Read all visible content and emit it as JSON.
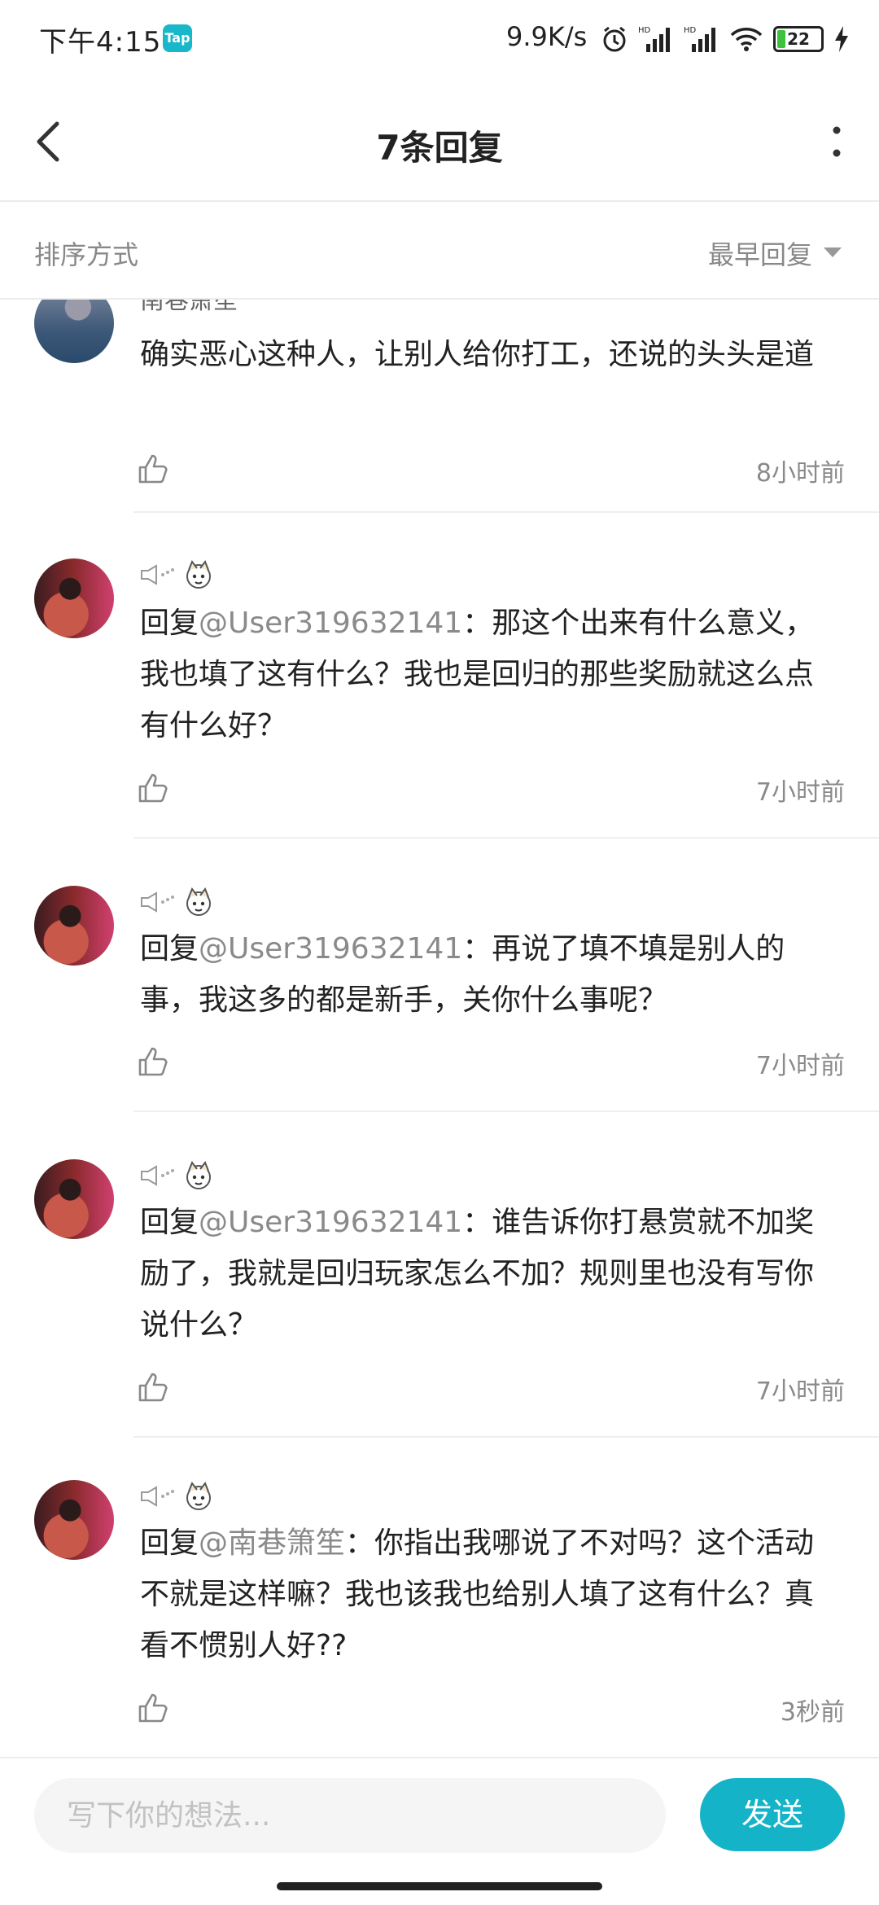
{
  "status_bar": {
    "time": "下午4:15",
    "app_badge": "Tap",
    "speed": "9.9K/s",
    "battery": "22"
  },
  "header": {
    "title": "7条回复",
    "icons": [
      "back-icon",
      "more-vertical-icon"
    ]
  },
  "sort": {
    "label": "排序方式",
    "value": "最早回复"
  },
  "comments": [
    {
      "author_partial": "南巷箫笙",
      "prefix": "",
      "mention": "",
      "separator": "",
      "text": "确实恶心这种人，让别人给你打工，还说的头头是道",
      "time": "8小时前"
    },
    {
      "prefix": "回复",
      "mention": "@User319632141",
      "separator": "：",
      "text": "那这个出来有什么意义，我也填了这有什么？我也是回归的那些奖励就这么点有什么好？",
      "time": "7小时前"
    },
    {
      "prefix": "回复",
      "mention": "@User319632141",
      "separator": "：",
      "text": "再说了填不填是别人的事，我这多的都是新手，关你什么事呢？",
      "time": "7小时前"
    },
    {
      "prefix": "回复",
      "mention": "@User319632141",
      "separator": "：",
      "text": "谁告诉你打悬赏就不加奖励了，我就是回归玩家怎么不加？规则里也没有写你说什么？",
      "time": "7小时前"
    },
    {
      "prefix": "回复",
      "mention": "@南巷箫笙",
      "separator": "：",
      "text": "你指出我哪说了不对吗？这个活动不就是这样嘛？我也该我也给别人填了这有什么？真看不惯别人好??",
      "time": "3秒前"
    }
  ],
  "composer": {
    "placeholder": "写下你的想法...",
    "send_label": "发送"
  },
  "colors": {
    "accent": "#14b3c7",
    "mention": "#8a8a8a",
    "muted": "#888888"
  }
}
